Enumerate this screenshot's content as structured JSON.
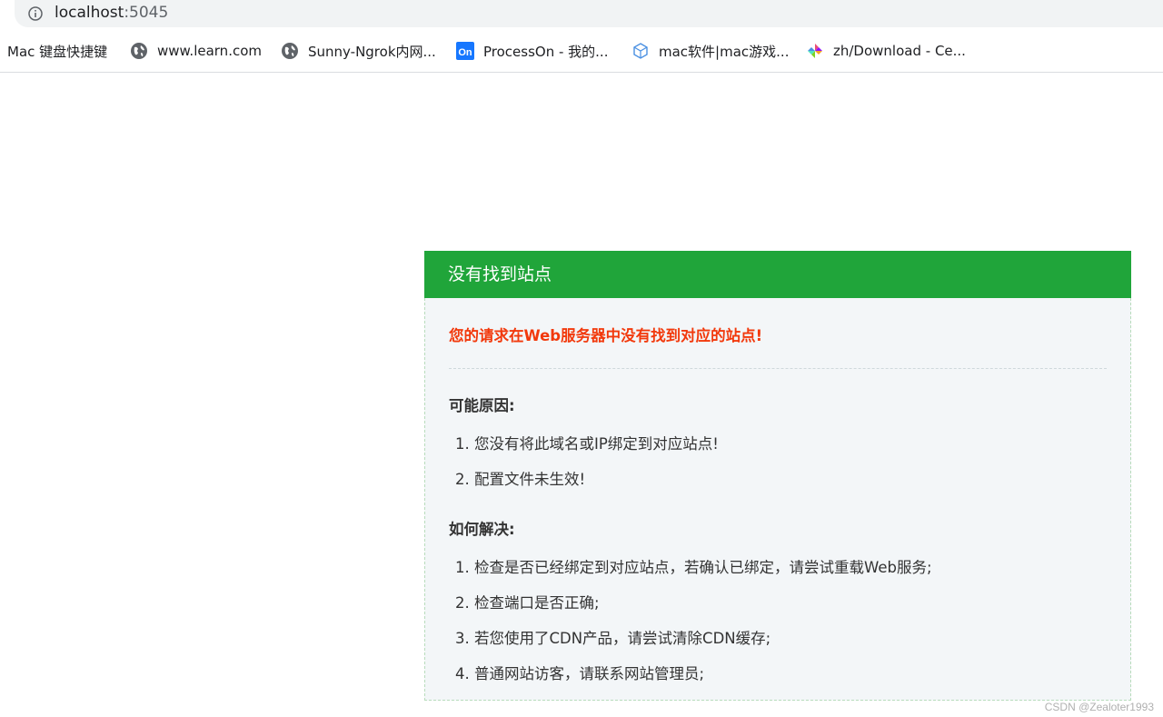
{
  "browser": {
    "url_host": "localhost",
    "url_port": ":5045",
    "bookmarks": [
      {
        "label": "Mac 键盘快捷键",
        "icon": "none"
      },
      {
        "label": "www.learn.com",
        "icon": "globe-icon"
      },
      {
        "label": "Sunny-Ngrok内网...",
        "icon": "globe-icon"
      },
      {
        "label": "ProcessOn - 我的...",
        "icon": "processon-icon"
      },
      {
        "label": "mac软件|mac游戏...",
        "icon": "cube-icon"
      },
      {
        "label": "zh/Download - Ce...",
        "icon": "pinwheel-icon"
      }
    ]
  },
  "page": {
    "header_title": "没有找到站点",
    "error_message": "您的请求在Web服务器中没有找到对应的站点!",
    "reasons_title": "可能原因:",
    "reasons": [
      "1. 您没有将此域名或IP绑定到对应站点!",
      "2. 配置文件未生效!"
    ],
    "solutions_title": "如何解决:",
    "solutions": [
      "1. 检查是否已经绑定到对应站点，若确认已绑定，请尝试重载Web服务;",
      "2. 检查端口是否正确;",
      "3. 若您使用了CDN产品，请尝试清除CDN缓存;",
      "4. 普通网站访客，请联系网站管理员;"
    ]
  },
  "watermark": "CSDN @Zealoter1993",
  "colors": {
    "header_green": "#20a53a",
    "error_red": "#f2390c",
    "body_bg": "#f3f6f8"
  }
}
